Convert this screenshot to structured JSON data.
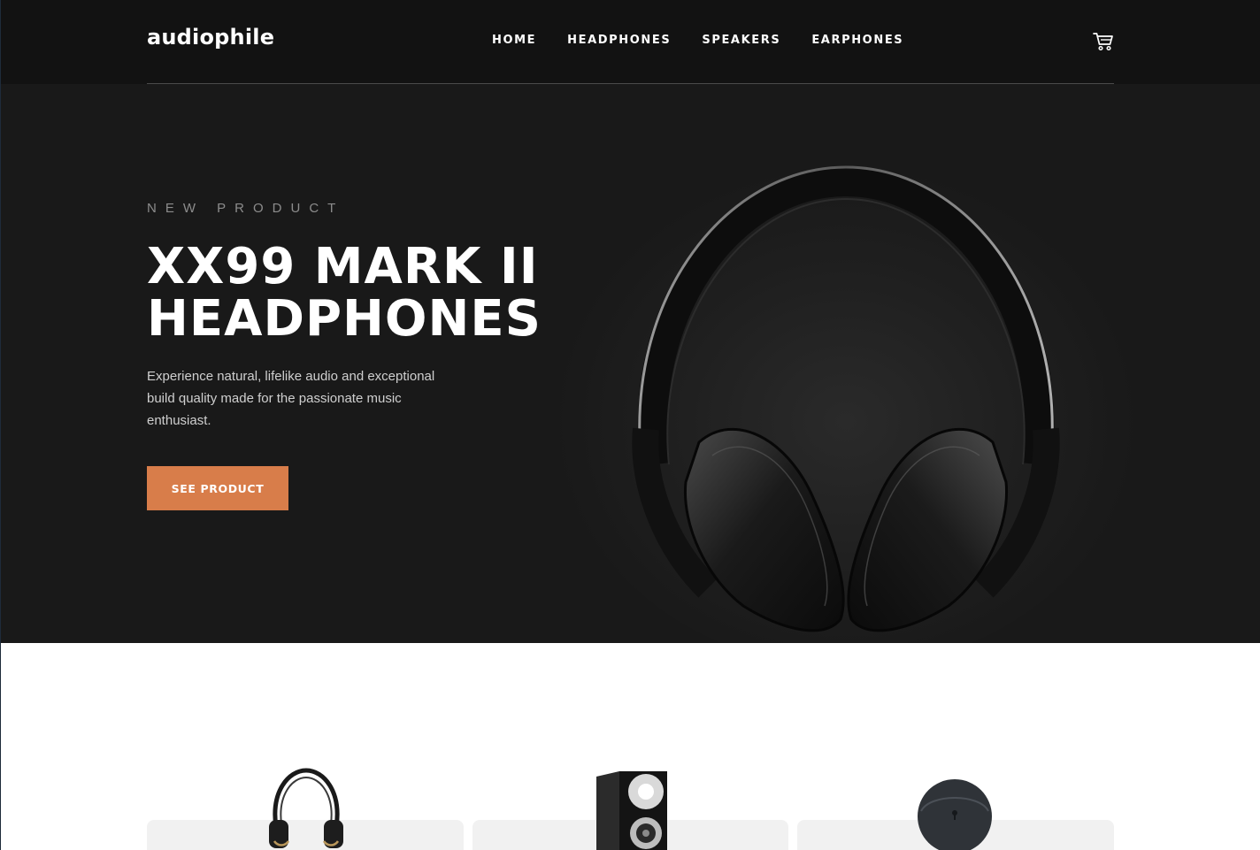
{
  "header": {
    "logo": "audiophile",
    "nav": [
      "HOME",
      "HEADPHONES",
      "SPEAKERS",
      "EARPHONES"
    ],
    "cart_icon": "cart-icon"
  },
  "hero": {
    "eyebrow": "NEW PRODUCT",
    "title_line1": "XX99 MARK II",
    "title_line2": "HEADPHONES",
    "description": "Experience natural, lifelike audio and exceptional build quality made for the passionate music enthusiast.",
    "cta_label": "SEE PRODUCT"
  },
  "categories": [
    {
      "image": "headphones"
    },
    {
      "image": "speaker"
    },
    {
      "image": "earphones"
    }
  ],
  "colors": {
    "accent": "#d87d4a",
    "header_bg": "#121212",
    "hero_bg": "#191919",
    "card_bg": "#f1f1f1"
  }
}
